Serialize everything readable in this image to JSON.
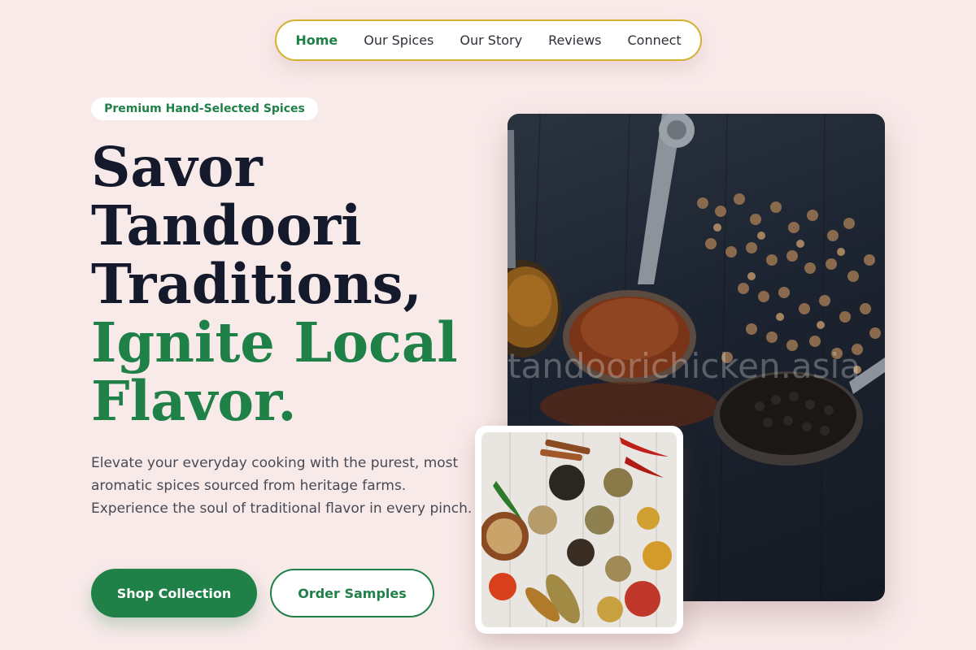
{
  "nav": {
    "items": [
      {
        "label": "Home",
        "active": true
      },
      {
        "label": "Our Spices",
        "active": false
      },
      {
        "label": "Our Story",
        "active": false
      },
      {
        "label": "Reviews",
        "active": false
      },
      {
        "label": "Connect",
        "active": false
      }
    ]
  },
  "hero": {
    "badge": "Premium Hand-Selected Spices",
    "headline_lines": [
      "Savor",
      "Tandoori",
      "Traditions,"
    ],
    "headline_accent_lines": [
      "Ignite Local",
      "Flavor."
    ],
    "description": "Elevate your everyday cooking with the purest, most aromatic spices sourced from heritage farms. Experience the soul of traditional flavor in every pinch.",
    "primary_button": "Shop Collection",
    "secondary_button": "Order Samples"
  },
  "images": {
    "main_watermark": "tandoorichicken.asia"
  },
  "colors": {
    "background": "#f9eaea",
    "brand_green": "#1f8048",
    "nav_border": "#d4b02f",
    "headline_dark": "#141a2b"
  }
}
